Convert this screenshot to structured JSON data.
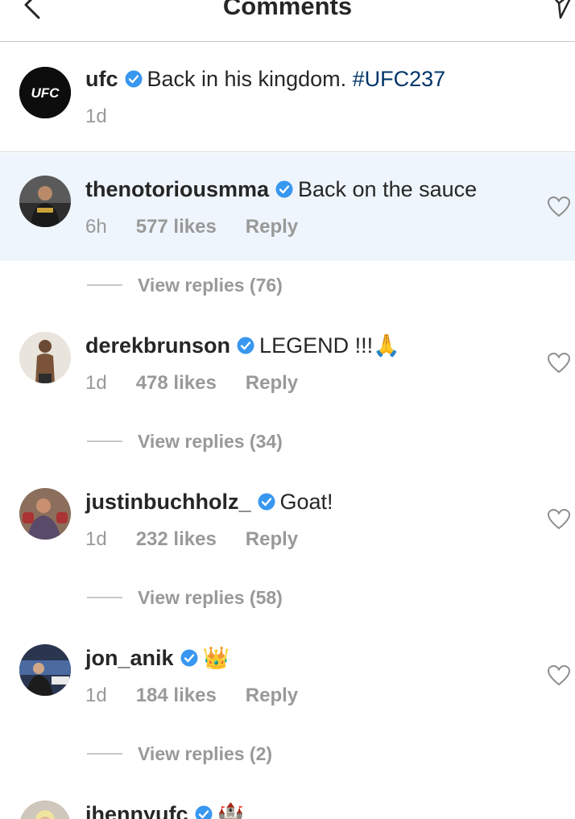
{
  "header": {
    "title": "Comments",
    "back_icon": "chevron-left-icon",
    "send_icon": "paper-plane-icon"
  },
  "caption": {
    "username": "ufc",
    "text": "Back in his kingdom. ",
    "hashtag": "#UFC237",
    "time": "1d",
    "avatar_text": "UFC"
  },
  "comments": [
    {
      "username": "thenotoriousmma",
      "text": "Back on the sauce",
      "time": "6h",
      "likes": "577 likes",
      "reply": "Reply",
      "view_replies": "View replies (76)",
      "highlighted": true
    },
    {
      "username": "derekbrunson",
      "text": "LEGEND !!!",
      "emoji": "🙏",
      "time": "1d",
      "likes": "478 likes",
      "reply": "Reply",
      "view_replies": "View replies (34)"
    },
    {
      "username": "justinbuchholz_",
      "text": "Goat!",
      "time": "1d",
      "likes": "232 likes",
      "reply": "Reply",
      "view_replies": "View replies (58)"
    },
    {
      "username": "jon_anik",
      "emoji": "👑",
      "time": "1d",
      "likes": "184 likes",
      "reply": "Reply",
      "view_replies": "View replies (2)"
    },
    {
      "username": "jhennyufc"
    }
  ],
  "colors": {
    "verified": "#3897f0",
    "hashtag": "#003569",
    "meta": "#999999",
    "highlight": "#eef5fc"
  }
}
